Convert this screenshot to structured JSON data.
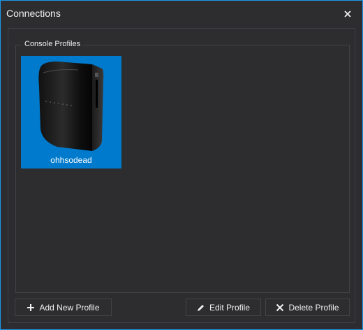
{
  "window": {
    "title": "Connections"
  },
  "group": {
    "label": "Console Profiles"
  },
  "profiles": [
    {
      "name": "ohhsodead"
    }
  ],
  "buttons": {
    "add": "Add New Profile",
    "edit": "Edit Profile",
    "delete": "Delete Profile"
  },
  "colors": {
    "accent": "#007acc",
    "border": "#1c97ea",
    "background": "#2d2d30"
  },
  "icons": {
    "close": "close-icon",
    "add": "plus-icon",
    "edit": "pencil-icon",
    "delete": "x-icon",
    "profile": "console-icon"
  }
}
